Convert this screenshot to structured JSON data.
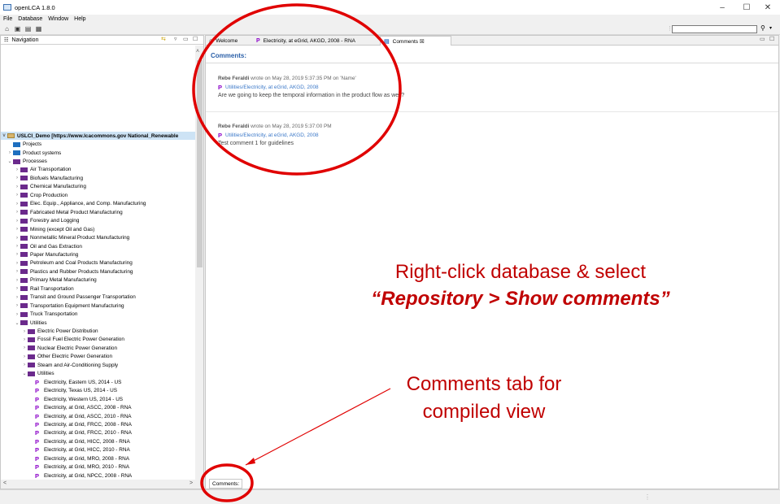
{
  "window": {
    "title": "openLCA 1.8.0",
    "controls": [
      "–",
      "☐",
      "✕"
    ]
  },
  "menu": [
    "File",
    "Database",
    "Window",
    "Help"
  ],
  "toolbar": {
    "search_value": ""
  },
  "navigation": {
    "title": "Navigation",
    "root": "USLCI_Demo [https://www.lcacommons.gov National_Renewable",
    "items": [
      {
        "label": "Projects",
        "indent": 1,
        "icon": "blue",
        "tw": ""
      },
      {
        "label": "Product systems",
        "indent": 1,
        "icon": "blue",
        "tw": ">"
      },
      {
        "label": "Processes",
        "indent": 1,
        "icon": "purple",
        "tw": "v"
      },
      {
        "label": "Air Transportation",
        "indent": 2,
        "icon": "purple",
        "tw": ">"
      },
      {
        "label": "Biofuels Manufacturing",
        "indent": 2,
        "icon": "purple",
        "tw": ">"
      },
      {
        "label": "Chemical Manufacturing",
        "indent": 2,
        "icon": "purple",
        "tw": ">"
      },
      {
        "label": "Crop Production",
        "indent": 2,
        "icon": "purple",
        "tw": ">"
      },
      {
        "label": "Elec. Equip., Appliance, and Comp. Manufacturing",
        "indent": 2,
        "icon": "purple",
        "tw": ">"
      },
      {
        "label": "Fabricated Metal Product Manufacturing",
        "indent": 2,
        "icon": "purple",
        "tw": ">"
      },
      {
        "label": "Forestry and Logging",
        "indent": 2,
        "icon": "purple",
        "tw": ">"
      },
      {
        "label": "Mining (except Oil and Gas)",
        "indent": 2,
        "icon": "purple",
        "tw": ">"
      },
      {
        "label": "Nonmetallic Mineral Product Manufacturing",
        "indent": 2,
        "icon": "purple",
        "tw": ">"
      },
      {
        "label": "Oil and Gas Extraction",
        "indent": 2,
        "icon": "purple",
        "tw": ">"
      },
      {
        "label": "Paper Manufacturing",
        "indent": 2,
        "icon": "purple",
        "tw": ">"
      },
      {
        "label": "Petroleum and Coal Products Manufacturing",
        "indent": 2,
        "icon": "purple",
        "tw": ">"
      },
      {
        "label": "Plastics and Rubber Products Manufacturing",
        "indent": 2,
        "icon": "purple",
        "tw": ">"
      },
      {
        "label": "Primary Metal Manufacturing",
        "indent": 2,
        "icon": "purple",
        "tw": ">"
      },
      {
        "label": "Rail Transportation",
        "indent": 2,
        "icon": "purple",
        "tw": ">"
      },
      {
        "label": "Transit and Ground Passenger Transportation",
        "indent": 2,
        "icon": "purple",
        "tw": ">"
      },
      {
        "label": "Transportation Equipment Manufacturing",
        "indent": 2,
        "icon": "purple",
        "tw": ">"
      },
      {
        "label": "Truck Transportation",
        "indent": 2,
        "icon": "purple",
        "tw": ">"
      },
      {
        "label": "Utilities",
        "indent": 2,
        "icon": "purple",
        "tw": "v"
      },
      {
        "label": "Electric Power Distribution",
        "indent": 3,
        "icon": "purple",
        "tw": ">"
      },
      {
        "label": "Fossil Fuel Electric Power Generation",
        "indent": 3,
        "icon": "purple",
        "tw": ">"
      },
      {
        "label": "Nuclear Electric Power Generation",
        "indent": 3,
        "icon": "purple",
        "tw": ">"
      },
      {
        "label": "Other Electric Power Generation",
        "indent": 3,
        "icon": "purple",
        "tw": ">"
      },
      {
        "label": "Steam and Air-Conditioning Supply",
        "indent": 3,
        "icon": "purple",
        "tw": ">"
      },
      {
        "label": "Utilities",
        "indent": 3,
        "icon": "purple",
        "tw": "v"
      },
      {
        "label": "Electricity, Eastern US, 2014 - US",
        "indent": 4,
        "icon": "process",
        "tw": ""
      },
      {
        "label": "Electricity, Texas US, 2014 - US",
        "indent": 4,
        "icon": "process",
        "tw": ""
      },
      {
        "label": "Electricity, Western US, 2014 - US",
        "indent": 4,
        "icon": "process",
        "tw": ""
      },
      {
        "label": "Electricity, at Grid, ASCC, 2008 - RNA",
        "indent": 4,
        "icon": "process",
        "tw": ""
      },
      {
        "label": "Electricity, at Grid, ASCC, 2010 - RNA",
        "indent": 4,
        "icon": "process",
        "tw": ""
      },
      {
        "label": "Electricity, at Grid, FRCC, 2008 - RNA",
        "indent": 4,
        "icon": "process",
        "tw": ""
      },
      {
        "label": "Electricity, at Grid, FRCC, 2010 - RNA",
        "indent": 4,
        "icon": "process",
        "tw": ""
      },
      {
        "label": "Electricity, at Grid, HICC, 2008 - RNA",
        "indent": 4,
        "icon": "process",
        "tw": ""
      },
      {
        "label": "Electricity, at Grid, HICC, 2010 - RNA",
        "indent": 4,
        "icon": "process",
        "tw": ""
      },
      {
        "label": "Electricity, at Grid, MRO, 2008 - RNA",
        "indent": 4,
        "icon": "process",
        "tw": ""
      },
      {
        "label": "Electricity, at Grid, MRO, 2010 - RNA",
        "indent": 4,
        "icon": "process",
        "tw": ""
      },
      {
        "label": "Electricity, at Grid, NPCC, 2008 - RNA",
        "indent": 4,
        "icon": "process",
        "tw": ""
      }
    ]
  },
  "editor": {
    "tabs": [
      {
        "label": "Welcome"
      },
      {
        "label": "Electricity, at eGrid, AKGD, 2008 - RNA"
      },
      {
        "label": "Comments  ☒"
      }
    ],
    "section_title": "Comments:",
    "comments": [
      {
        "author": "Rebe Feraldi",
        "meta": " wrote on May 28, 2019 5:37:35 PM on 'Name'",
        "link": "Utilities/Electricity, at eGrid, AKGD, 2008",
        "body": "Are we going to keep the temporal information in the product flow as well?"
      },
      {
        "author": "Rebe Feraldi",
        "meta": " wrote on May 28, 2019 5:37:00 PM",
        "link": "Utilities/Electricity, at eGrid, AKGD, 2008",
        "body": "Test comment 1 for guidelines"
      }
    ],
    "bottom_tab": "Comments:"
  },
  "annotations": {
    "callout1_line1": "Right-click database & select",
    "callout1_line2": "“Repository > Show comments”",
    "callout2_line1": "Comments tab for",
    "callout2_line2": "compiled view",
    "color": "#e00000"
  }
}
